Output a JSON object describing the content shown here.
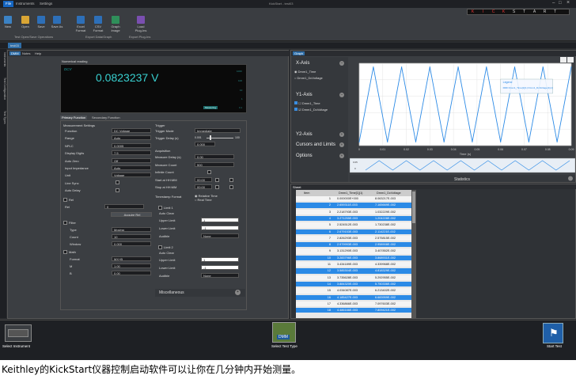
{
  "window_title": "KickStart - test03",
  "menu": {
    "file": "File",
    "instruments": "Instruments",
    "settings": "Settings"
  },
  "ribbon": {
    "buttons": [
      "New",
      "Open",
      "Save",
      "Save As",
      "Excel Format",
      "CSV Format",
      "Graph Image",
      "Load Plug-Ins"
    ],
    "groups": [
      "Test Open/Save Operations",
      "Export Data/Graph",
      "Export Plug-Ins"
    ]
  },
  "brand_letters": [
    "K",
    "I",
    "C",
    "K",
    "S",
    "T",
    "A",
    "R",
    "T"
  ],
  "doc_tab": "test03",
  "side_tabs": [
    "Instruments",
    "Test Configuration",
    "Test Types"
  ],
  "left_tabs": [
    "DMM",
    "Notes",
    "Help"
  ],
  "numerical_reading": {
    "title": "Numerical reading",
    "mode": "DCV",
    "value": "0.0823237 V",
    "scale_labels": [
      "1000",
      "100",
      "10",
      "1",
      "0.1"
    ],
    "badge": "Measuring"
  },
  "function_tabs": [
    "Primary Function",
    "Secondary Function"
  ],
  "measurement_settings": {
    "title": "Measurement Settings",
    "rows": [
      {
        "label": "Function",
        "value": "DC Voltage"
      },
      {
        "label": "Range",
        "value": "Auto"
      },
      {
        "label": "NPLC",
        "value": "0.0005"
      },
      {
        "label": "Display Digits",
        "value": "7.5"
      },
      {
        "label": "Auto Zero",
        "value": "Off"
      },
      {
        "label": "Input Impedance",
        "value": "Auto"
      },
      {
        "label": "Unit",
        "value": "Voltage"
      },
      {
        "label": "Line Sync",
        "value": ""
      },
      {
        "label": "Auto Delay",
        "value": ""
      }
    ],
    "rel_label": "Rel",
    "rel_value": "0",
    "acquire_button": "Acquire Rel",
    "filter_label": "Filter",
    "filter_rows": [
      {
        "label": "Type",
        "value": "Moving"
      },
      {
        "label": "Count",
        "value": "10"
      },
      {
        "label": "Window",
        "value": "0.000"
      }
    ],
    "math_label": "Math",
    "math_rows": [
      {
        "label": "Format",
        "value": "MX+B"
      },
      {
        "label": "M",
        "value": "1.00"
      },
      {
        "label": "B",
        "value": "0.00"
      }
    ]
  },
  "trigger": {
    "title": "Trigger",
    "mode_label": "Trigger Mode",
    "mode_value": "Immediate",
    "delay_label": "Trigger Delay (s)",
    "delay_min": "0.001",
    "delay_max": "100",
    "delay_value": "0.000"
  },
  "acquisition": {
    "title": "Acquisition",
    "rows": [
      {
        "label": "Measure Delay (s)",
        "value": "0.00"
      },
      {
        "label": "Measure Count",
        "value": "500"
      },
      {
        "label": "Infinite Count",
        "value": ""
      },
      {
        "label": "Start at HH:MM",
        "value": "00:00"
      },
      {
        "label": "Stop at HH:MM",
        "value": "00:00"
      }
    ],
    "timestamp_label": "Timestamp Format",
    "ts_opt1": "Relative Time",
    "ts_opt2": "Real Time"
  },
  "limits": [
    {
      "title": "Limit 1",
      "auto_clear": "Auto Clear",
      "upper": "Upper Limit",
      "upper_v": "1",
      "lower": "Lower Limit",
      "lower_v": "-1",
      "audible": "Audible",
      "audible_v": "None"
    },
    {
      "title": "Limit 2",
      "auto_clear": "Auto Clear",
      "upper": "Upper Limit",
      "upper_v": "1",
      "lower": "Lower Limit",
      "lower_v": "-1",
      "audible": "Audible",
      "audible_v": "None"
    }
  ],
  "miscellaneous": "Miscellaneous",
  "graph_tab": "Graph",
  "graph_side": {
    "x_axis": "X-Axis",
    "x_opts": [
      "Dmm1_Time",
      "Dmm1_DcVoltage"
    ],
    "y1_axis": "Y1-Axis",
    "y1_opts": [
      "Dmm1_Time",
      "Dmm1_DcVoltage"
    ],
    "y2_axis": "Y2-Axis",
    "cursors": "Cursors and Limits",
    "options": "Options"
  },
  "chart_data": {
    "type": "line",
    "xlabel": "Time (s)",
    "x_ticks": [
      "0",
      "0.01",
      "0.02",
      "0.03",
      "0.04",
      "0.05",
      "0.06",
      "0.07",
      "0.08",
      "0.09"
    ],
    "legend_title": "Legend",
    "legend_entry": "Dmm1_Time[1](1) Dmm1_DcVoltage(1)(1)",
    "series": [
      {
        "name": "Dmm1_Time[1](1) Dmm1_DcVoltage(1)(1)",
        "x": [
          0,
          0.006,
          0.012,
          0.018,
          0.024,
          0.03,
          0.036,
          0.042,
          0.048,
          0.054,
          0.06,
          0.066,
          0.072,
          0.078,
          0.084,
          0.09
        ],
        "y": [
          -1,
          1,
          -1,
          1,
          -1,
          1,
          -1,
          1,
          -1,
          1,
          -1,
          1,
          -1,
          1,
          -1,
          1
        ]
      }
    ],
    "scroll_labels": [
      "0.05",
      "0"
    ]
  },
  "statistics": "Statistics",
  "sheet": {
    "title": "Sheet",
    "columns": [
      "Item",
      "Dmm1_Time[1](1)",
      "Dmm1_DcVoltage"
    ],
    "rows": [
      [
        "1",
        "0.000000E+000",
        "8.063217E-003"
      ],
      [
        "2",
        "2.659311E-003",
        "7.165669E-002"
      ],
      [
        "3",
        "2.218793E-003",
        "1.032229E-002"
      ],
      [
        "4",
        "3.271255E-003",
        "1.204228E-002"
      ],
      [
        "5",
        "2.524512E-003",
        "1.730238E-002"
      ],
      [
        "6",
        "2.679153E-003",
        "2.114221E-002"
      ],
      [
        "7",
        "2.826293E-003",
        "2.575815E-002"
      ],
      [
        "8",
        "2.979993E-003",
        "2.958908E-002"
      ],
      [
        "9",
        "3.131290E-003",
        "3.407852E-002"
      ],
      [
        "10",
        "3.283796E-003",
        "3.868931E-002"
      ],
      [
        "11",
        "3.434189E-003",
        "4.339968E-002"
      ],
      [
        "12",
        "3.585304E-003",
        "4.818329E-002"
      ],
      [
        "13",
        "3.735628E-003",
        "5.292955E-002"
      ],
      [
        "14",
        "3.884320E-003",
        "5.750336E-002"
      ],
      [
        "15",
        "4.034087E-003",
        "6.213402E-002"
      ],
      [
        "16",
        "4.185427E-003",
        "6.683959E-002"
      ],
      [
        "17",
        "4.336866E-003",
        "7.097603E-002"
      ],
      [
        "18",
        "4.486166E-003",
        "7.809421E-002"
      ]
    ]
  },
  "status": {
    "select_instrument": "Select Instrument",
    "select_test_type": "Select Test Type",
    "dmm_icon_label": "DMM",
    "start_test": "Start Test"
  },
  "caption": "Keithley的KickStart仪器控制启动软件可以让你在几分钟内开始测量。"
}
